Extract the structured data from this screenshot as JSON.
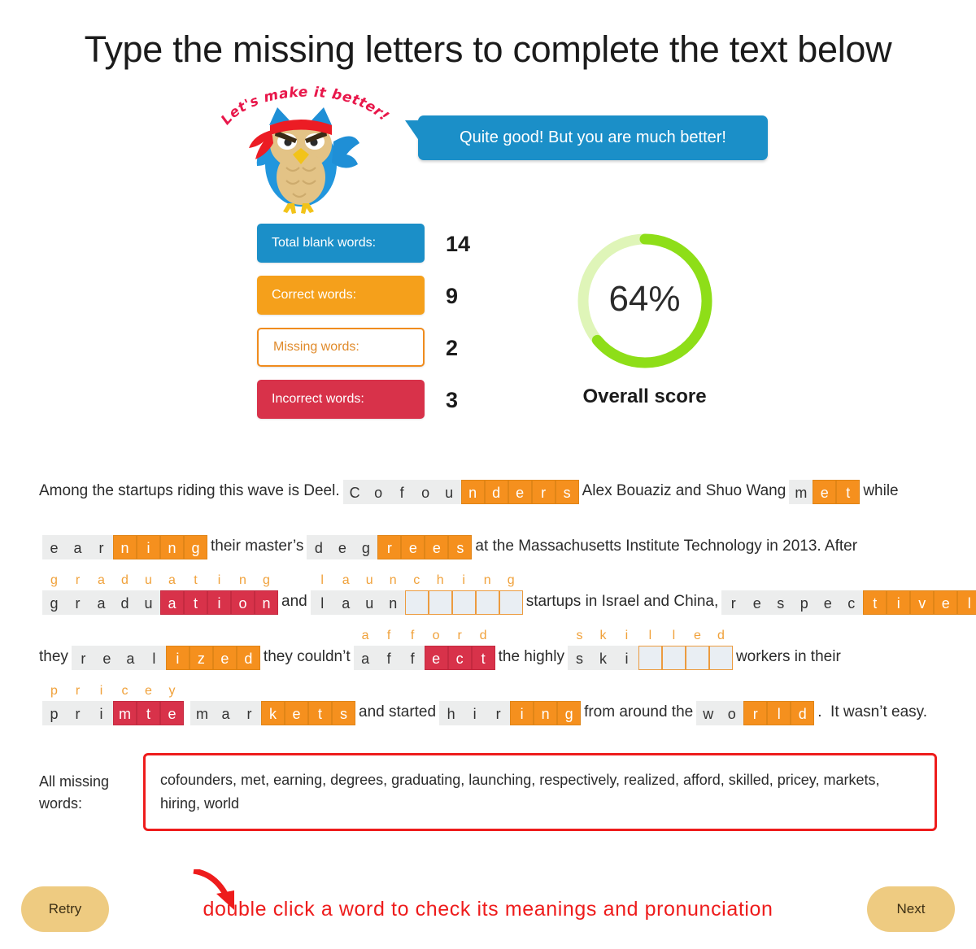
{
  "title": "Type the missing letters to complete the text below",
  "mascot": {
    "banner_text": "Let's make it better!",
    "icon": "ninja-owl-icon",
    "bubble_text": "Quite good! But you are much better!"
  },
  "stats": {
    "rows": [
      {
        "label": "Total blank words:",
        "value": "14",
        "style": "blue",
        "color": "#1b8fc8"
      },
      {
        "label": "Correct words:",
        "value": "9",
        "style": "orange",
        "color": "#f5a01b"
      },
      {
        "label": "Missing words:",
        "value": "2",
        "style": "hollow",
        "color": "#f08c1e"
      },
      {
        "label": "Incorrect words:",
        "value": "3",
        "style": "red",
        "color": "#d8324a"
      }
    ]
  },
  "score": {
    "percent_label": "64%",
    "percent_value": 64,
    "caption": "Overall score",
    "ring_color": "#8ede18",
    "ring_track_color": "#dff5b8"
  },
  "exercise": {
    "lines": [
      [
        {
          "type": "text",
          "text": "Among the startups riding this wave is Deel."
        },
        {
          "type": "word",
          "hint": "",
          "letters": [
            {
              "c": "C",
              "s": "grey"
            },
            {
              "c": "o",
              "s": "grey"
            },
            {
              "c": "f",
              "s": "grey"
            },
            {
              "c": "o",
              "s": "grey"
            },
            {
              "c": "u",
              "s": "grey"
            },
            {
              "c": "n",
              "s": "orange"
            },
            {
              "c": "d",
              "s": "orange"
            },
            {
              "c": "e",
              "s": "orange"
            },
            {
              "c": "r",
              "s": "orange"
            },
            {
              "c": "s",
              "s": "orange"
            }
          ]
        },
        {
          "type": "text",
          "text": "Alex Bouaziz and Shuo Wang"
        },
        {
          "type": "word",
          "hint": "",
          "letters": [
            {
              "c": "m",
              "s": "grey"
            },
            {
              "c": "e",
              "s": "orange"
            },
            {
              "c": "t",
              "s": "orange"
            }
          ]
        },
        {
          "type": "text",
          "text": "while"
        }
      ],
      [
        {
          "type": "word",
          "hint": "",
          "letters": [
            {
              "c": "e",
              "s": "grey"
            },
            {
              "c": "a",
              "s": "grey"
            },
            {
              "c": "r",
              "s": "grey"
            },
            {
              "c": "n",
              "s": "orange"
            },
            {
              "c": "i",
              "s": "orange"
            },
            {
              "c": "n",
              "s": "orange"
            },
            {
              "c": "g",
              "s": "orange"
            }
          ]
        },
        {
          "type": "text",
          "text": "their master’s"
        },
        {
          "type": "word",
          "hint": "",
          "letters": [
            {
              "c": "d",
              "s": "grey"
            },
            {
              "c": "e",
              "s": "grey"
            },
            {
              "c": "g",
              "s": "grey"
            },
            {
              "c": "r",
              "s": "orange"
            },
            {
              "c": "e",
              "s": "orange"
            },
            {
              "c": "e",
              "s": "orange"
            },
            {
              "c": "s",
              "s": "orange"
            }
          ]
        },
        {
          "type": "text",
          "text": "at the Massachusetts Institute Technology in 2013. After"
        }
      ],
      [
        {
          "type": "word",
          "hint": "graduating",
          "letters": [
            {
              "c": "g",
              "s": "grey"
            },
            {
              "c": "r",
              "s": "grey"
            },
            {
              "c": "a",
              "s": "grey"
            },
            {
              "c": "d",
              "s": "grey"
            },
            {
              "c": "u",
              "s": "grey"
            },
            {
              "c": "a",
              "s": "red"
            },
            {
              "c": "t",
              "s": "red"
            },
            {
              "c": "i",
              "s": "red"
            },
            {
              "c": "o",
              "s": "red"
            },
            {
              "c": "n",
              "s": "red"
            }
          ]
        },
        {
          "type": "text",
          "text": "and"
        },
        {
          "type": "word",
          "hint": "launching",
          "letters": [
            {
              "c": "l",
              "s": "grey"
            },
            {
              "c": "a",
              "s": "grey"
            },
            {
              "c": "u",
              "s": "grey"
            },
            {
              "c": "n",
              "s": "grey"
            },
            {
              "c": "",
              "s": "empty"
            },
            {
              "c": "",
              "s": "empty"
            },
            {
              "c": "",
              "s": "empty"
            },
            {
              "c": "",
              "s": "empty"
            },
            {
              "c": "",
              "s": "empty"
            }
          ]
        },
        {
          "type": "text",
          "text": "startups in Israel and China,"
        },
        {
          "type": "word",
          "hint": "",
          "letters": [
            {
              "c": "r",
              "s": "grey"
            },
            {
              "c": "e",
              "s": "grey"
            },
            {
              "c": "s",
              "s": "grey"
            },
            {
              "c": "p",
              "s": "grey"
            },
            {
              "c": "e",
              "s": "grey"
            },
            {
              "c": "c",
              "s": "grey"
            },
            {
              "c": "t",
              "s": "orange"
            },
            {
              "c": "i",
              "s": "orange"
            },
            {
              "c": "v",
              "s": "orange"
            },
            {
              "c": "e",
              "s": "orange"
            },
            {
              "c": "l",
              "s": "orange"
            },
            {
              "c": "y",
              "s": "orange"
            }
          ]
        },
        {
          "type": "punct",
          "text": ","
        }
      ],
      [
        {
          "type": "text",
          "text": "they"
        },
        {
          "type": "word",
          "hint": "",
          "letters": [
            {
              "c": "r",
              "s": "grey"
            },
            {
              "c": "e",
              "s": "grey"
            },
            {
              "c": "a",
              "s": "grey"
            },
            {
              "c": "l",
              "s": "grey"
            },
            {
              "c": "i",
              "s": "orange"
            },
            {
              "c": "z",
              "s": "orange"
            },
            {
              "c": "e",
              "s": "orange"
            },
            {
              "c": "d",
              "s": "orange"
            }
          ]
        },
        {
          "type": "text",
          "text": "they couldn’t"
        },
        {
          "type": "word",
          "hint": "afford",
          "letters": [
            {
              "c": "a",
              "s": "grey"
            },
            {
              "c": "f",
              "s": "grey"
            },
            {
              "c": "f",
              "s": "grey"
            },
            {
              "c": "e",
              "s": "red"
            },
            {
              "c": "c",
              "s": "red"
            },
            {
              "c": "t",
              "s": "red"
            }
          ]
        },
        {
          "type": "text",
          "text": "the highly"
        },
        {
          "type": "word",
          "hint": "skilled",
          "letters": [
            {
              "c": "s",
              "s": "grey"
            },
            {
              "c": "k",
              "s": "grey"
            },
            {
              "c": "i",
              "s": "grey"
            },
            {
              "c": "",
              "s": "empty"
            },
            {
              "c": "",
              "s": "empty"
            },
            {
              "c": "",
              "s": "empty"
            },
            {
              "c": "",
              "s": "empty"
            }
          ]
        },
        {
          "type": "text",
          "text": "workers in their"
        }
      ],
      [
        {
          "type": "word",
          "hint": "pricey",
          "letters": [
            {
              "c": "p",
              "s": "grey"
            },
            {
              "c": "r",
              "s": "grey"
            },
            {
              "c": "i",
              "s": "grey"
            },
            {
              "c": "m",
              "s": "red"
            },
            {
              "c": "t",
              "s": "red"
            },
            {
              "c": "e",
              "s": "red"
            }
          ]
        },
        {
          "type": "word",
          "hint": "",
          "letters": [
            {
              "c": "m",
              "s": "grey"
            },
            {
              "c": "a",
              "s": "grey"
            },
            {
              "c": "r",
              "s": "grey"
            },
            {
              "c": "k",
              "s": "orange"
            },
            {
              "c": "e",
              "s": "orange"
            },
            {
              "c": "t",
              "s": "orange"
            },
            {
              "c": "s",
              "s": "orange"
            }
          ]
        },
        {
          "type": "text",
          "text": "and started"
        },
        {
          "type": "word",
          "hint": "",
          "letters": [
            {
              "c": "h",
              "s": "grey"
            },
            {
              "c": "i",
              "s": "grey"
            },
            {
              "c": "r",
              "s": "grey"
            },
            {
              "c": "i",
              "s": "orange"
            },
            {
              "c": "n",
              "s": "orange"
            },
            {
              "c": "g",
              "s": "orange"
            }
          ]
        },
        {
          "type": "text",
          "text": "from around the"
        },
        {
          "type": "word",
          "hint": "",
          "letters": [
            {
              "c": "w",
              "s": "grey"
            },
            {
              "c": "o",
              "s": "grey"
            },
            {
              "c": "r",
              "s": "orange"
            },
            {
              "c": "l",
              "s": "orange"
            },
            {
              "c": "d",
              "s": "orange"
            }
          ]
        },
        {
          "type": "punct",
          "text": "."
        },
        {
          "type": "text",
          "text": "  It wasn’t easy."
        }
      ]
    ]
  },
  "missing": {
    "label": "All missing words:",
    "words": "cofounders, met, earning, degrees, graduating, launching, respectively, realized, afford, skilled, pricey, markets, hiring, world"
  },
  "footer": {
    "retry_label": "Retry",
    "next_label": "Next",
    "note": "double click a word to check its meanings and pronunciation",
    "note_color": "#ee1c1c"
  }
}
